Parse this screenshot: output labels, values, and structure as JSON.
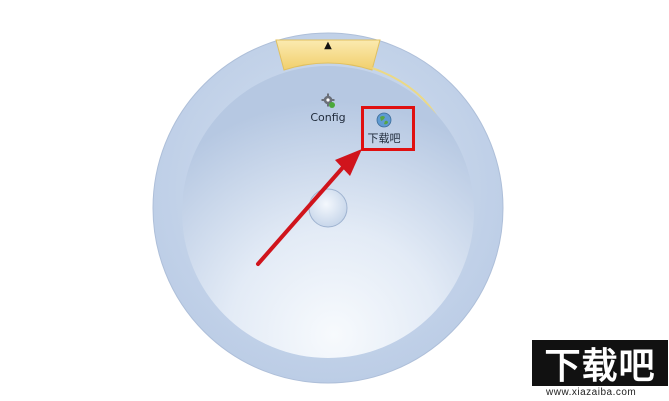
{
  "launcher": {
    "collapse_glyph": "▲",
    "items": [
      {
        "label": "Config",
        "icon": "gear-icon"
      },
      {
        "label": "下载吧",
        "icon": "globe-icon"
      }
    ]
  },
  "watermark": {
    "logo_text": "下载吧",
    "url": "www.xiazaiba.com"
  },
  "colors": {
    "dial_outer": "#c5d5ea",
    "dial_inner": "#dfe8f4",
    "tab": "#f6dc8a",
    "highlight": "#e01010",
    "arrow": "#d0141c"
  }
}
